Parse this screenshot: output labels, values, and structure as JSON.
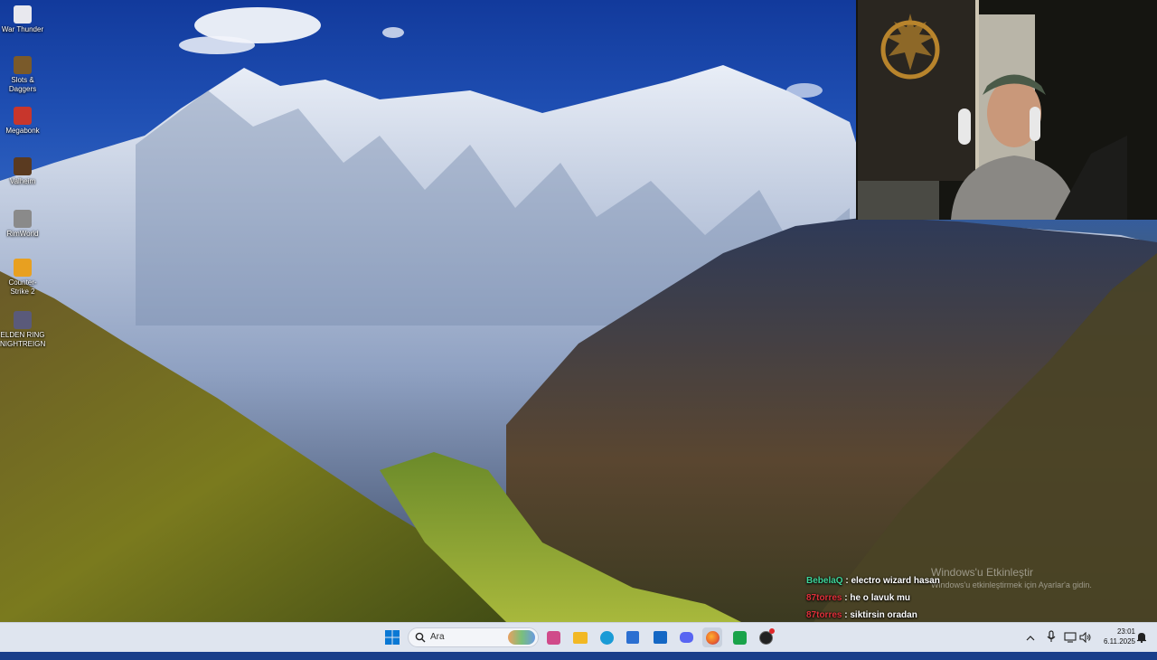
{
  "desktop_icons": [
    {
      "label": "War Thunder",
      "icon": "war-thunder-icon",
      "color": "#e8e8ee"
    },
    {
      "label": "Slots & Daggers",
      "icon": "slots-daggers-icon",
      "color": "#7a5a2a"
    },
    {
      "label": "Megabonk",
      "icon": "megabonk-icon",
      "color": "#c8362c"
    },
    {
      "label": "Valheim",
      "icon": "valheim-icon",
      "color": "#5a3a20"
    },
    {
      "label": "RimWorld",
      "icon": "rimworld-icon",
      "color": "#8a8a8a"
    },
    {
      "label": "Counter-Strike 2",
      "icon": "counter-strike-icon",
      "color": "#e8a020"
    },
    {
      "label": "ELDEN RING NIGHTREIGN",
      "icon": "elden-ring-icon",
      "color": "#5a5a7a"
    }
  ],
  "chat": [
    {
      "user": "BebelaQ",
      "user_color": "#3ed69a",
      "message": "electro wizard hasan"
    },
    {
      "user": "87torres",
      "user_color": "#e0303a",
      "message": "he o lavuk mu"
    },
    {
      "user": "87torres",
      "user_color": "#e0303a",
      "message": "siktirsin oradan"
    }
  ],
  "watermark": {
    "title": "Windows'u Etkinleştir",
    "subtitle": "Windows'u etkinleştirmek için Ayarlar'a gidin."
  },
  "taskbar": {
    "search_placeholder": "Ara",
    "apps": [
      {
        "name": "widgets-icon",
        "color": "#d04a8a"
      },
      {
        "name": "file-explorer-icon",
        "color": "#f2b824"
      },
      {
        "name": "edge-icon",
        "color": "#1a9bd6"
      },
      {
        "name": "store-icon",
        "color": "#2b6fd1"
      },
      {
        "name": "outlook-icon",
        "color": "#1467c4"
      },
      {
        "name": "discord-icon",
        "color": "#5865f2"
      },
      {
        "name": "firefox-icon",
        "color": "#e8602c"
      },
      {
        "name": "xbox-icon",
        "color": "#1aa34a"
      },
      {
        "name": "obs-icon",
        "color": "#222222"
      }
    ],
    "clock_time": "23:01",
    "clock_date": "6.11.2025"
  }
}
